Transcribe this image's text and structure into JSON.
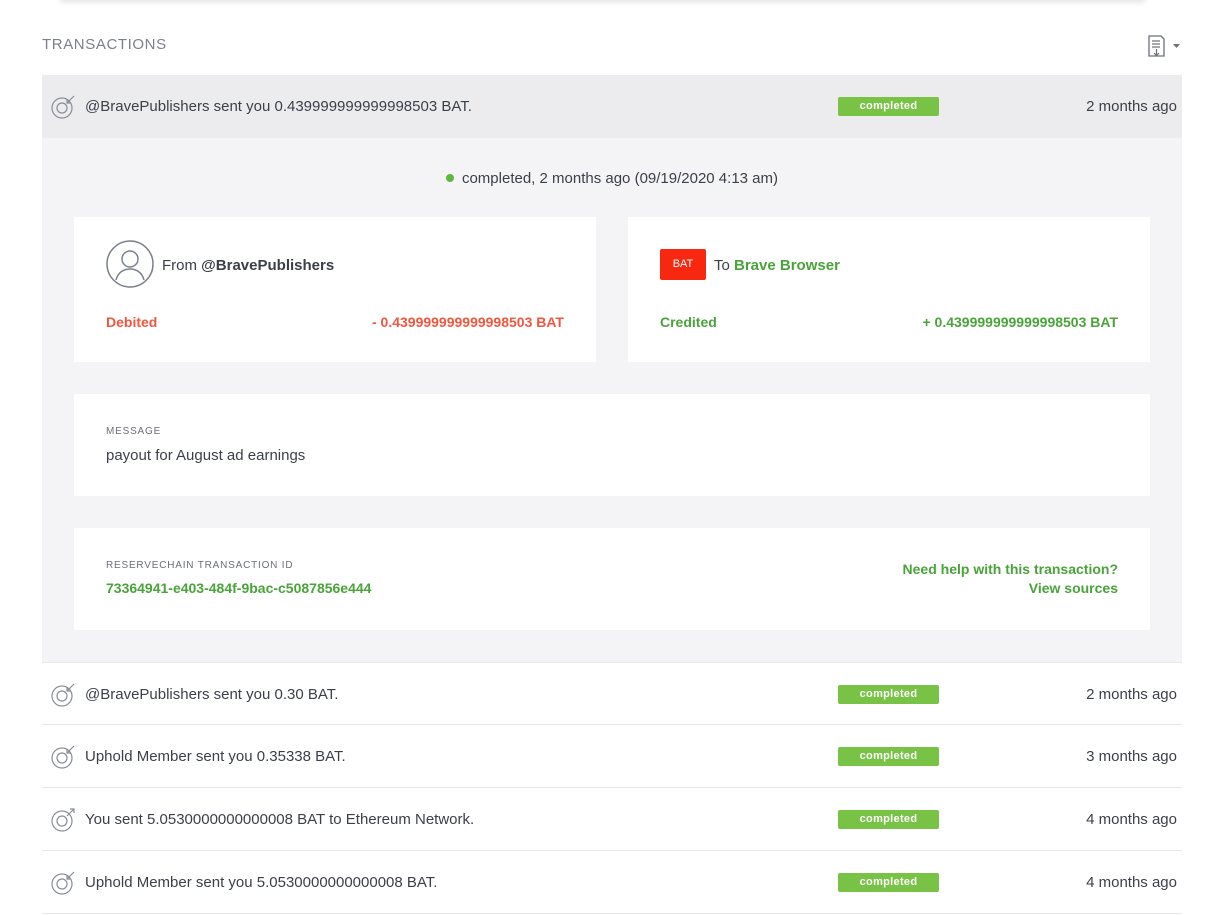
{
  "section": {
    "title": "TRANSACTIONS",
    "export_icon": "export-document-icon"
  },
  "expanded": {
    "row": {
      "description": "@BravePublishers sent you 0.439999999999998503 BAT.",
      "status": "completed",
      "time": "2 months ago",
      "direction": "incoming"
    },
    "status_line": "completed, 2 months ago (09/19/2020 4:13 am)",
    "from": {
      "prefix": "From",
      "name": "@BravePublishers",
      "amount_label": "Debited",
      "amount": "- 0.439999999999998503 BAT"
    },
    "to": {
      "logo": "BAT",
      "prefix": "To",
      "name": "Brave Browser",
      "amount_label": "Credited",
      "amount": "+ 0.439999999999998503 BAT"
    },
    "message": {
      "label": "MESSAGE",
      "text": "payout for August ad earnings"
    },
    "txid": {
      "label": "RESERVECHAIN TRANSACTION ID",
      "value": "73364941-e403-484f-9bac-c5087856e444",
      "help_line1": "Need help with this transaction?",
      "help_line2": "View sources"
    }
  },
  "transactions": [
    {
      "description": "@BravePublishers sent you 0.30 BAT.",
      "status": "completed",
      "time": "2 months ago",
      "direction": "incoming"
    },
    {
      "description": "Uphold Member sent you 0.35338 BAT.",
      "status": "completed",
      "time": "3 months ago",
      "direction": "incoming"
    },
    {
      "description": "You sent 5.0530000000000008 BAT to Ethereum Network.",
      "status": "completed",
      "time": "4 months ago",
      "direction": "outgoing"
    },
    {
      "description": "Uphold Member sent you 5.0530000000000008 BAT.",
      "status": "completed",
      "time": "4 months ago",
      "direction": "incoming"
    }
  ],
  "colors": {
    "completed_badge": "#78c346",
    "debit": "#f0573f",
    "credit": "#4aa33a",
    "bat_logo": "#f7280f"
  }
}
